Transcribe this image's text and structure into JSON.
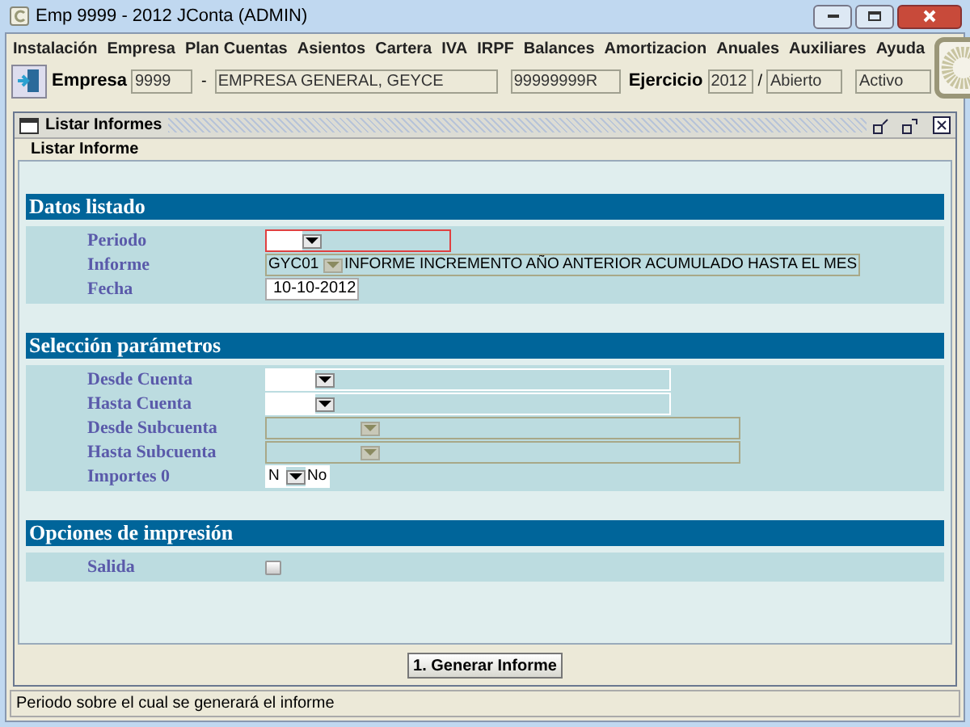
{
  "window": {
    "title": "Emp 9999 - 2012 JConta (ADMIN)"
  },
  "menu": [
    "Instalación",
    "Empresa",
    "Plan Cuentas",
    "Asientos",
    "Cartera",
    "IVA",
    "IRPF",
    "Balances",
    "Amortizacion",
    "Anuales",
    "Auxiliares",
    "Ayuda"
  ],
  "toolbar": {
    "empresa_label": "Empresa",
    "empresa_code": "9999",
    "separator": "-",
    "empresa_name": "EMPRESA GENERAL, GEYCE",
    "nif": "99999999R",
    "ejercicio_label": "Ejercicio",
    "ejercicio": "2012",
    "slash": "/",
    "estado": "Abierto",
    "situacion": "Activo"
  },
  "internal_frame": {
    "title": "Listar Informes",
    "tab": "Listar Informe"
  },
  "sections": [
    {
      "title": "Datos listado",
      "fields": [
        {
          "label": "Periodo",
          "kind": "combo",
          "error": true,
          "disabled": false
        },
        {
          "label": "Informe",
          "kind": "combo",
          "value": "GYC01",
          "description": "INFORME INCREMENTO AÑO ANTERIOR ACUMULADO HASTA EL MES",
          "error": false,
          "disabled": true
        },
        {
          "label": "Fecha",
          "kind": "date",
          "value": "10-10-2012"
        }
      ]
    },
    {
      "title": "Selección parámetros",
      "fields": [
        {
          "label": "Desde Cuenta",
          "kind": "combo",
          "error": false,
          "disabled": false
        },
        {
          "label": "Hasta Cuenta",
          "kind": "combo",
          "error": false,
          "disabled": false
        },
        {
          "label": "Desde Subcuenta",
          "kind": "combo",
          "error": false,
          "disabled": true
        },
        {
          "label": "Hasta Subcuenta",
          "kind": "combo",
          "error": false,
          "disabled": true
        },
        {
          "label": "Importes 0",
          "kind": "combo",
          "value": "N",
          "description": "No",
          "error": false,
          "disabled": false
        }
      ]
    },
    {
      "title": "Opciones de impresión",
      "fields": [
        {
          "label": "Salida",
          "kind": "checkbox",
          "checked": false
        }
      ]
    }
  ],
  "action_button": "1. Generar Informe",
  "status_bar": "Periodo sobre el cual se generará el informe"
}
